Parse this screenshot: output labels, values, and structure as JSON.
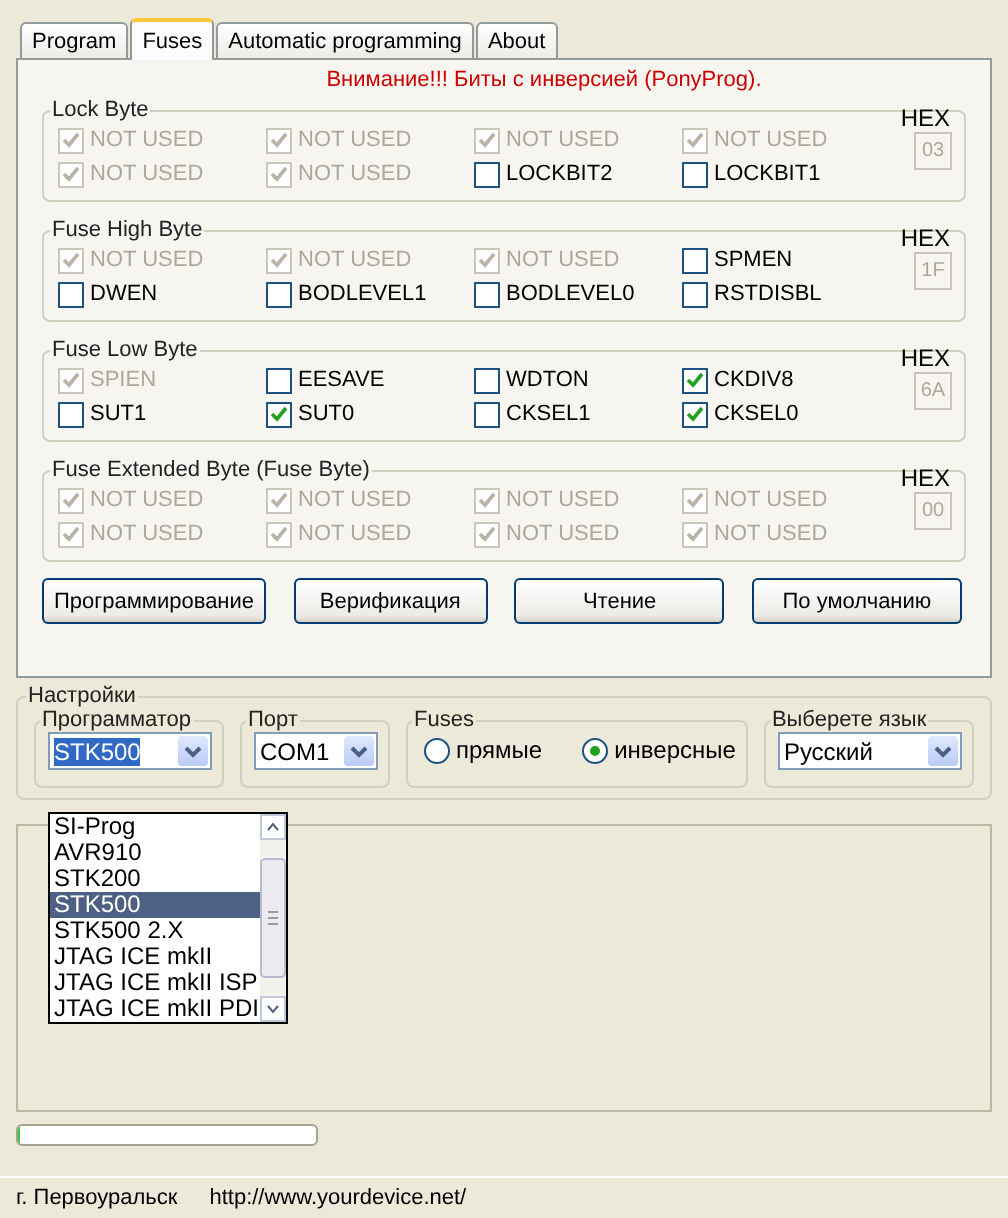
{
  "tabs": [
    {
      "label": "Program",
      "selected": false
    },
    {
      "label": "Fuses",
      "selected": true
    },
    {
      "label": "Automatic programming",
      "selected": false
    },
    {
      "label": "About",
      "selected": false
    }
  ],
  "warning": "Внимание!!! Биты с инверсией (PonyProg).",
  "fuse_groups": [
    {
      "title": "Lock Byte",
      "hex_label": "HEX",
      "hex": "03",
      "bits": [
        {
          "label": "NOT USED",
          "checked": true,
          "disabled": true
        },
        {
          "label": "NOT USED",
          "checked": true,
          "disabled": true
        },
        {
          "label": "NOT USED",
          "checked": true,
          "disabled": true
        },
        {
          "label": "NOT USED",
          "checked": true,
          "disabled": true
        },
        {
          "label": "NOT USED",
          "checked": true,
          "disabled": true
        },
        {
          "label": "NOT USED",
          "checked": true,
          "disabled": true
        },
        {
          "label": "LOCKBIT2",
          "checked": false,
          "disabled": false
        },
        {
          "label": "LOCKBIT1",
          "checked": false,
          "disabled": false
        }
      ]
    },
    {
      "title": "Fuse High Byte",
      "hex_label": "HEX",
      "hex": "1F",
      "bits": [
        {
          "label": "NOT USED",
          "checked": true,
          "disabled": true
        },
        {
          "label": "NOT USED",
          "checked": true,
          "disabled": true
        },
        {
          "label": "NOT USED",
          "checked": true,
          "disabled": true
        },
        {
          "label": "SPMEN",
          "checked": false,
          "disabled": false
        },
        {
          "label": "DWEN",
          "checked": false,
          "disabled": false
        },
        {
          "label": "BODLEVEL1",
          "checked": false,
          "disabled": false
        },
        {
          "label": "BODLEVEL0",
          "checked": false,
          "disabled": false
        },
        {
          "label": "RSTDISBL",
          "checked": false,
          "disabled": false
        }
      ]
    },
    {
      "title": "Fuse Low Byte",
      "hex_label": "HEX",
      "hex": "6A",
      "bits": [
        {
          "label": "SPIEN",
          "checked": true,
          "disabled": true
        },
        {
          "label": "EESAVE",
          "checked": false,
          "disabled": false
        },
        {
          "label": "WDTON",
          "checked": false,
          "disabled": false
        },
        {
          "label": "CKDIV8",
          "checked": true,
          "disabled": false
        },
        {
          "label": "SUT1",
          "checked": false,
          "disabled": false
        },
        {
          "label": "SUT0",
          "checked": true,
          "disabled": false
        },
        {
          "label": "CKSEL1",
          "checked": false,
          "disabled": false
        },
        {
          "label": "CKSEL0",
          "checked": true,
          "disabled": false
        }
      ]
    },
    {
      "title": "Fuse Extended Byte (Fuse Byte)",
      "hex_label": "HEX",
      "hex": "00",
      "bits": [
        {
          "label": "NOT USED",
          "checked": true,
          "disabled": true
        },
        {
          "label": "NOT USED",
          "checked": true,
          "disabled": true
        },
        {
          "label": "NOT USED",
          "checked": true,
          "disabled": true
        },
        {
          "label": "NOT USED",
          "checked": true,
          "disabled": true
        },
        {
          "label": "NOT USED",
          "checked": true,
          "disabled": true
        },
        {
          "label": "NOT USED",
          "checked": true,
          "disabled": true
        },
        {
          "label": "NOT USED",
          "checked": true,
          "disabled": true
        },
        {
          "label": "NOT USED",
          "checked": true,
          "disabled": true
        }
      ]
    }
  ],
  "buttons": [
    "Программирование",
    "Верификация",
    "Чтение",
    "По умолчанию"
  ],
  "settings": {
    "title": "Настройки",
    "programmer": {
      "label": "Программатор",
      "value": "STK500",
      "focused": true,
      "expanded": true,
      "options": [
        {
          "label": "SI-Prog",
          "selected": false
        },
        {
          "label": "AVR910",
          "selected": false
        },
        {
          "label": "STK200",
          "selected": false
        },
        {
          "label": "STK500",
          "selected": true
        },
        {
          "label": "STK500 2.X",
          "selected": false
        },
        {
          "label": "JTAG ICE mkII",
          "selected": false
        },
        {
          "label": "JTAG ICE mkII ISP",
          "selected": false
        },
        {
          "label": "JTAG ICE mkII PDI",
          "selected": false
        }
      ]
    },
    "port": {
      "label": "Порт",
      "value": "COM1"
    },
    "fuses": {
      "label": "Fuses",
      "options": [
        {
          "label": "прямые",
          "selected": false
        },
        {
          "label": "инверсные",
          "selected": true
        }
      ]
    },
    "language": {
      "label": "Выберете язык",
      "value": "Русский"
    }
  },
  "progress": {
    "level": 0.01
  },
  "status_bar": [
    "г. Первоуральск",
    "http://www.yourdevice.net/"
  ]
}
